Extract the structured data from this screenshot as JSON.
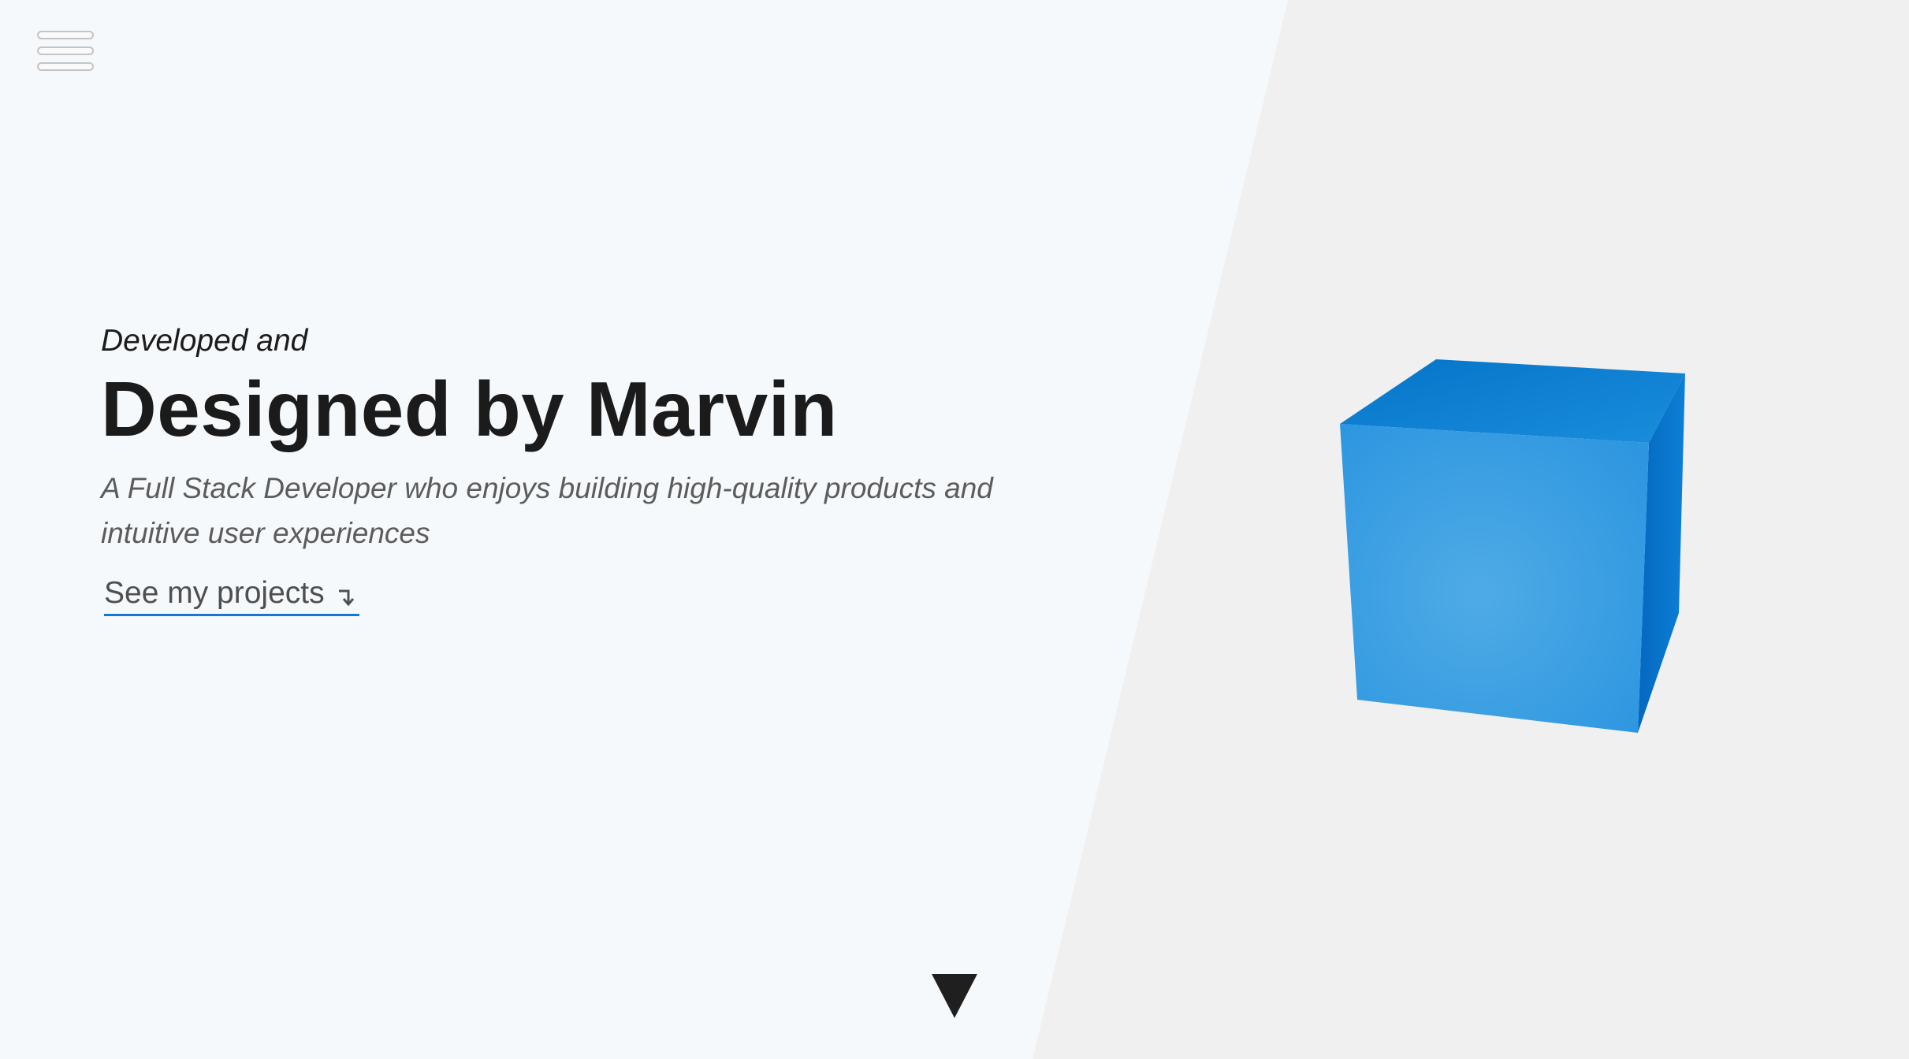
{
  "nav": {
    "menu_icon": "hamburger-menu-icon"
  },
  "hero": {
    "kicker": "Developed and",
    "title": "Designed by Marvin",
    "subtitle": "A Full Stack Developer who enjoys building high-quality products and intuitive user experiences",
    "cta_label": "See my projects",
    "cta_icon": "arrow-down-right-icon"
  },
  "scroll": {
    "icon": "triangle-down-icon"
  },
  "colors": {
    "accent": "#1877d2",
    "left_background": "#f6f9fb",
    "right_background": "#f0f0f0",
    "cube_front": "#3fa3e6",
    "cube_top": "#0b7fd4",
    "cube_side": "#0a6fc8"
  }
}
